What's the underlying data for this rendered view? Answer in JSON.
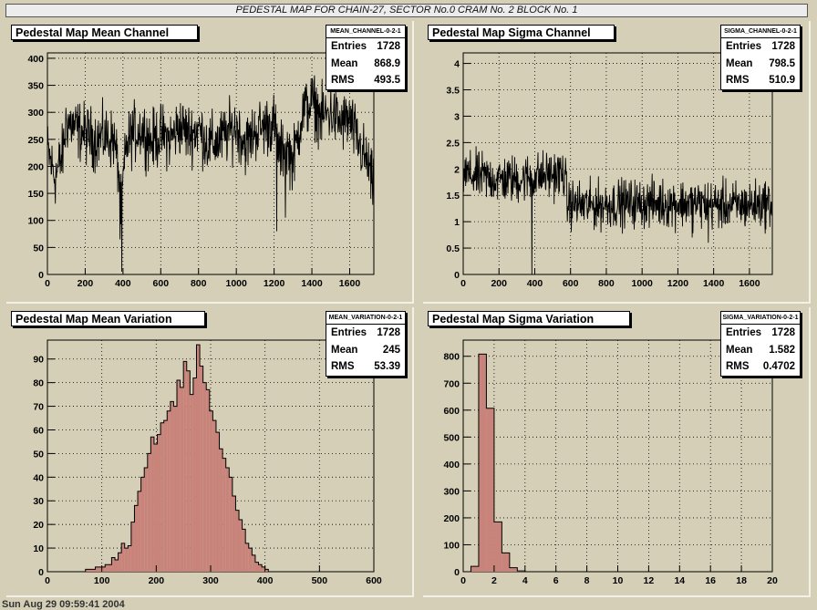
{
  "page_title": "PEDESTAL MAP FOR CHAIN-27, SECTOR No.0 CRAM No. 2 BLOCK No. 1",
  "footer_date": "Sun Aug 29 09:59:41 2004",
  "colors": {
    "background": "#d4cfb6",
    "hist_fill": "#c8847a",
    "line": "#000000"
  },
  "chart_data": [
    {
      "type": "line",
      "title": "Pedestal Map Mean Channel",
      "stats": {
        "name": "MEAN_CHANNEL-0-2-1",
        "rows": [
          {
            "label": "Entries",
            "value": "1728"
          },
          {
            "label": "Mean",
            "value": "868.9"
          },
          {
            "label": "RMS",
            "value": "493.5"
          }
        ]
      },
      "xlim": [
        0,
        1728
      ],
      "ylim": [
        0,
        410
      ],
      "xticks": [
        0,
        200,
        400,
        600,
        800,
        1000,
        1200,
        1400,
        1600
      ],
      "yticks": [
        0,
        50,
        100,
        150,
        200,
        250,
        300,
        350,
        400
      ],
      "grid": true,
      "profile": {
        "x": [
          0,
          40,
          80,
          100,
          150,
          200,
          250,
          300,
          350,
          375,
          390,
          400,
          420,
          450,
          500,
          550,
          600,
          650,
          700,
          750,
          800,
          850,
          900,
          950,
          1000,
          1050,
          1100,
          1150,
          1200,
          1230,
          1260,
          1300,
          1350,
          1400,
          1450,
          1500,
          1550,
          1600,
          1650,
          1700,
          1728
        ],
        "y": [
          230,
          180,
          220,
          285,
          270,
          260,
          250,
          255,
          250,
          200,
          120,
          170,
          240,
          260,
          270,
          245,
          260,
          250,
          275,
          260,
          270,
          240,
          245,
          260,
          275,
          240,
          265,
          275,
          280,
          220,
          240,
          210,
          300,
          320,
          290,
          300,
          280,
          285,
          240,
          200,
          150
        ]
      },
      "noise_amplitude": 55,
      "dips": [
        {
          "x": 385,
          "y": 65
        },
        {
          "x": 395,
          "y": 5
        },
        {
          "x": 1215,
          "y": 80
        },
        {
          "x": 1260,
          "y": 105
        }
      ]
    },
    {
      "type": "line",
      "title": "Pedestal Map Sigma Channel",
      "stats": {
        "name": "SIGMA_CHANNEL-0-2-1",
        "rows": [
          {
            "label": "Entries",
            "value": "1728"
          },
          {
            "label": "Mean",
            "value": "798.5"
          },
          {
            "label": "RMS",
            "value": "510.9"
          }
        ]
      },
      "xlim": [
        0,
        1728
      ],
      "ylim": [
        0,
        4.2
      ],
      "xticks": [
        0,
        200,
        400,
        600,
        800,
        1000,
        1200,
        1400,
        1600
      ],
      "yticks": [
        0,
        0.5,
        1,
        1.5,
        2,
        2.5,
        3,
        3.5,
        4
      ],
      "ytick_labels": [
        "0",
        "0.5",
        "1",
        "1.5",
        "2",
        "2.5",
        "3",
        "3.5",
        "4"
      ],
      "grid": true,
      "profile": {
        "x": [
          0,
          100,
          200,
          300,
          400,
          500,
          570,
          580,
          700,
          900,
          1100,
          1300,
          1500,
          1728
        ],
        "y": [
          1.9,
          1.85,
          1.8,
          1.8,
          1.85,
          1.9,
          1.9,
          1.35,
          1.3,
          1.35,
          1.35,
          1.35,
          1.3,
          1.35
        ]
      },
      "noise_amplitude": 0.45,
      "dips": [
        {
          "x": 385,
          "y": 0.0
        },
        {
          "x": 1280,
          "y": 0.7
        },
        {
          "x": 1370,
          "y": 0.6
        }
      ]
    },
    {
      "type": "bar",
      "title": "Pedestal Map Mean Variation",
      "stats": {
        "name": "MEAN_VARIATION-0-2-1",
        "rows": [
          {
            "label": "Entries",
            "value": "1728"
          },
          {
            "label": "Mean",
            "value": "245"
          },
          {
            "label": "RMS",
            "value": "53.39"
          }
        ]
      },
      "xlim": [
        0,
        600
      ],
      "ylim": [
        0,
        98
      ],
      "xticks": [
        0,
        100,
        200,
        300,
        400,
        500,
        600
      ],
      "yticks": [
        0,
        10,
        20,
        30,
        40,
        50,
        60,
        70,
        80,
        90
      ],
      "grid": true,
      "bin_start": 70,
      "bin_width": 6,
      "values": [
        1,
        1,
        1,
        2,
        2,
        2,
        3,
        3,
        6,
        5,
        8,
        12,
        10,
        11,
        21,
        28,
        34,
        40,
        44,
        50,
        57,
        54,
        58,
        63,
        64,
        68,
        72,
        70,
        81,
        78,
        89,
        85,
        75,
        82,
        96,
        87,
        80,
        77,
        68,
        64,
        59,
        52,
        48,
        44,
        40,
        32,
        26,
        22,
        18,
        12,
        10,
        7,
        4,
        3,
        2,
        1
      ]
    },
    {
      "type": "bar",
      "title": "Pedestal Map Sigma Variation",
      "stats": {
        "name": "SIGMA_VARIATION-0-2-1",
        "rows": [
          {
            "label": "Entries",
            "value": "1728"
          },
          {
            "label": "Mean",
            "value": "1.582"
          },
          {
            "label": "RMS",
            "value": "0.4702"
          }
        ]
      },
      "xlim": [
        0,
        20
      ],
      "ylim": [
        0,
        860
      ],
      "xticks": [
        0,
        2,
        4,
        6,
        8,
        10,
        12,
        14,
        16,
        18,
        20
      ],
      "yticks": [
        0,
        100,
        200,
        300,
        400,
        500,
        600,
        700,
        800
      ],
      "grid": true,
      "bin_start": 0.5,
      "bin_width": 0.5,
      "values": [
        20,
        808,
        607,
        185,
        70,
        15,
        3
      ]
    }
  ]
}
